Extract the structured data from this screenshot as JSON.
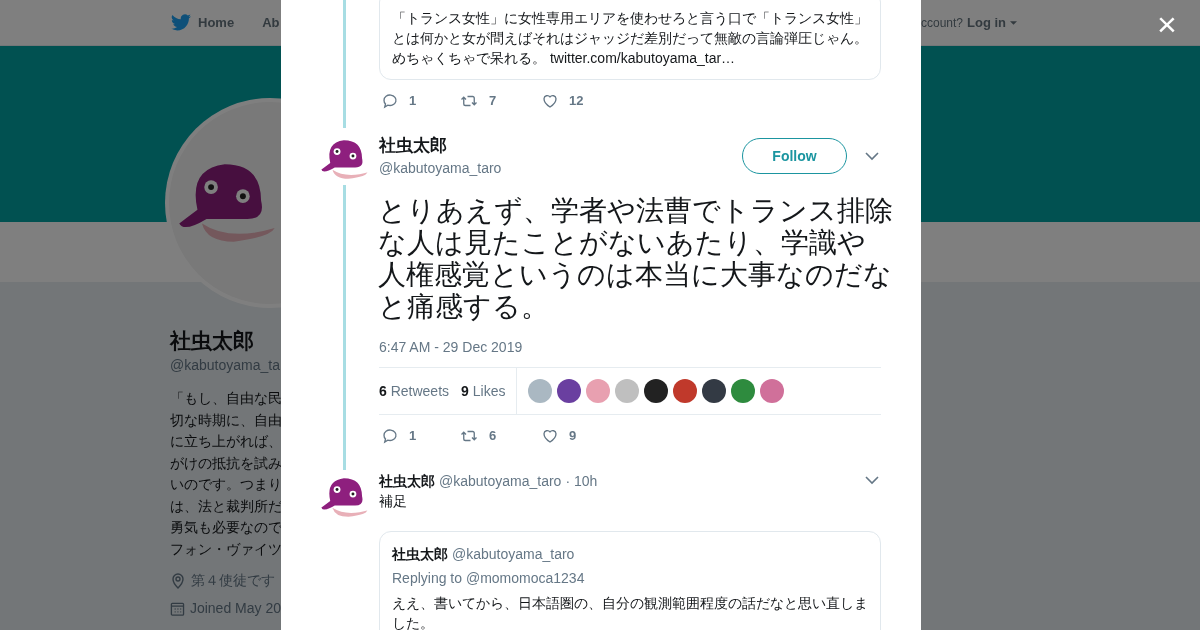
{
  "background_page": {
    "nav": {
      "items": [
        "Home",
        "Ab"
      ],
      "account_prompt": "ccount?",
      "login": "Log in"
    },
    "profile": {
      "name": "社虫太郎",
      "handle": "@kabutoyama_ta",
      "bio_lines": [
        "「もし、自由な民",
        "切な時期に、自由",
        "に立ち上がれば、",
        "がけの抵抗を試み",
        "いのです。つまり",
        "は、法と裁判所だ",
        "勇気も必要なので",
        "フォン・ヴァイツ"
      ],
      "location": "第４使徒です",
      "joined": "Joined May 20"
    }
  },
  "modal": {
    "close": "×",
    "previous_tweet": {
      "quote_lines": [
        "「トランス女性」に女性専用エリアを使わせろと言う口で「トランス女性」",
        "とは何かと女が問えばそれはジャッジだ差別だって無敵の言論弾圧じゃん。",
        "めちゃくちゃで呆れる。 twitter.com/kabutoyama_tar…"
      ],
      "replies": "1",
      "retweets": "7",
      "likes": "12"
    },
    "main_tweet": {
      "name": "社虫太郎",
      "handle": "@kabutoyama_taro",
      "follow": "Follow",
      "text_lines": [
        "とりあえず、学者や法曹でトランス排除",
        "な人は見たことがないあたり、学識や",
        "人権感覚というのは本当に大事なのだな",
        "と痛感する。"
      ],
      "timestamp": "6:47 AM - 29 Dec 2019",
      "retweet_count": "6",
      "retweet_label": "Retweets",
      "like_count": "9",
      "like_label": "Likes",
      "liker_avatars": [
        {
          "color": "#aab8c2"
        },
        {
          "color": "#6a3fa0"
        },
        {
          "color": "#e8a0b0"
        },
        {
          "color": "#bfbfbf"
        },
        {
          "color": "#222222"
        },
        {
          "color": "#c0392b"
        },
        {
          "color": "#333a44"
        },
        {
          "color": "#2e8b3e"
        },
        {
          "color": "#d0709a"
        }
      ],
      "replies": "1",
      "retweets": "6",
      "likes": "9"
    },
    "reply_tweet": {
      "name": "社虫太郎",
      "handle": "@kabutoyama_taro",
      "time": "· 10h",
      "text": "補足",
      "quote": {
        "name": "社虫太郎",
        "handle": "@kabutoyama_taro",
        "replying_to": "Replying to @momomoca1234",
        "text": "ええ、書いてから、日本語圏の、自分の観測範囲程度の話だなと思い直しました。"
      }
    }
  }
}
